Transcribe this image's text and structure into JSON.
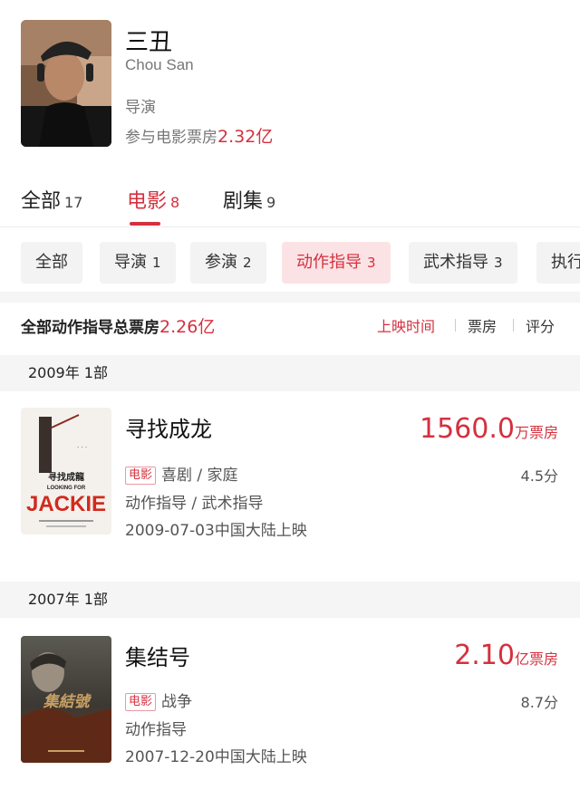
{
  "person": {
    "name_cn": "三丑",
    "name_en": "Chou San",
    "role": "导演",
    "box_label": "参与电影票房",
    "box_value": "2.32亿"
  },
  "main_tabs": [
    {
      "label": "全部",
      "count": "17"
    },
    {
      "label": "电影",
      "count": "8",
      "active": true
    },
    {
      "label": "剧集",
      "count": "9"
    }
  ],
  "filters": [
    {
      "label": "全部",
      "count": ""
    },
    {
      "label": "导演",
      "count": "1"
    },
    {
      "label": "参演",
      "count": "2"
    },
    {
      "label": "动作指导",
      "count": "3",
      "active": true
    },
    {
      "label": "武术指导",
      "count": "3"
    },
    {
      "label": "执行",
      "count": ""
    }
  ],
  "summary": {
    "label": "全部动作指导总票房",
    "value": "2.26亿",
    "sort": [
      "上映时间",
      "票房",
      "评分"
    ],
    "active_sort": "上映时间"
  },
  "groups": [
    {
      "year": "2009年 1部",
      "movies": [
        {
          "title": "寻找成龙",
          "box_number": "1560.0",
          "box_unit": "万票房",
          "tag": "电影",
          "genre": "喜剧 / 家庭",
          "score": "4.5分",
          "jobs": "动作指导 / 武术指导",
          "release": "2009-07-03中国大陆上映",
          "poster_text": [
            "寻找成龍",
            "LOOKING FOR",
            "JACKIE"
          ]
        }
      ]
    },
    {
      "year": "2007年 1部",
      "movies": [
        {
          "title": "集结号",
          "box_number": "2.10",
          "box_unit": "亿票房",
          "tag": "电影",
          "genre": "战争",
          "score": "8.7分",
          "jobs": "动作指导",
          "release": "2007-12-20中国大陆上映",
          "poster_text": [
            "集結號"
          ]
        }
      ]
    }
  ],
  "colors": {
    "accent": "#d5303f",
    "accent_bg": "#fbe3e5",
    "chip_bg": "#f3f3f3",
    "band_bg": "#f5f5f5"
  }
}
